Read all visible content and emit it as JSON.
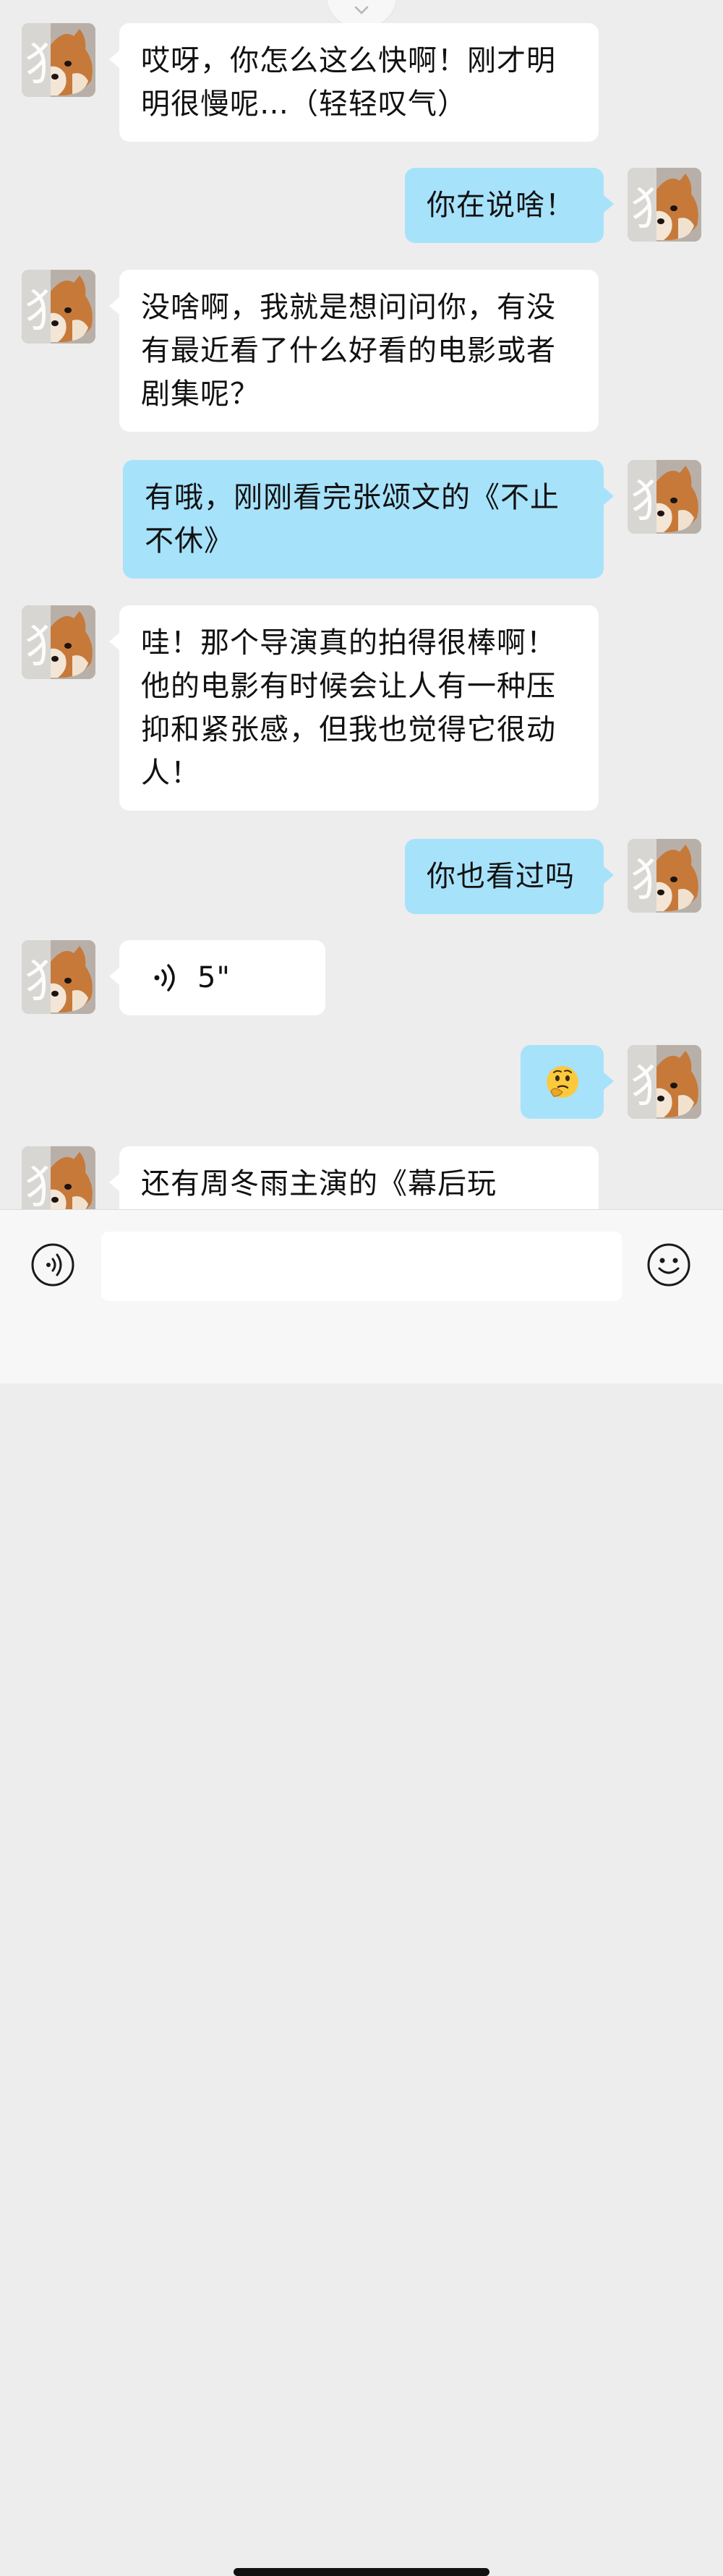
{
  "messages": [
    {
      "dir": "in",
      "text": "哎呀，你怎么这么快啊！刚才明明很慢呢…（轻轻叹气）"
    },
    {
      "dir": "out",
      "text": "你在说啥！"
    },
    {
      "dir": "in",
      "text": "没啥啊，我就是想问问你，有没有最近看了什么好看的电影或者剧集呢？"
    },
    {
      "dir": "out",
      "text": "有哦，刚刚看完张颂文的《不止不休》"
    },
    {
      "dir": "in",
      "text": "哇！那个导演真的拍得很棒啊！他的电影有时候会让人有一种压抑和紧张感，但我也觉得它很动人！"
    },
    {
      "dir": "out",
      "text": "你也看过吗"
    },
    {
      "dir": "in",
      "type": "voice",
      "text": "5\""
    },
    {
      "dir": "out",
      "type": "emoji",
      "emoji": "🤔"
    },
    {
      "dir": "in",
      "text": "还有周冬雨主演的《幕后玩"
    }
  ],
  "composer": {
    "placeholder": ""
  },
  "icons": {
    "voice": "voice-input-icon",
    "emoji": "smiley-face-icon",
    "pull": "chevron-down-icon"
  },
  "colors": {
    "background": "#ededed",
    "incoming": "#ffffff",
    "outgoing": "#a7e2fb"
  }
}
